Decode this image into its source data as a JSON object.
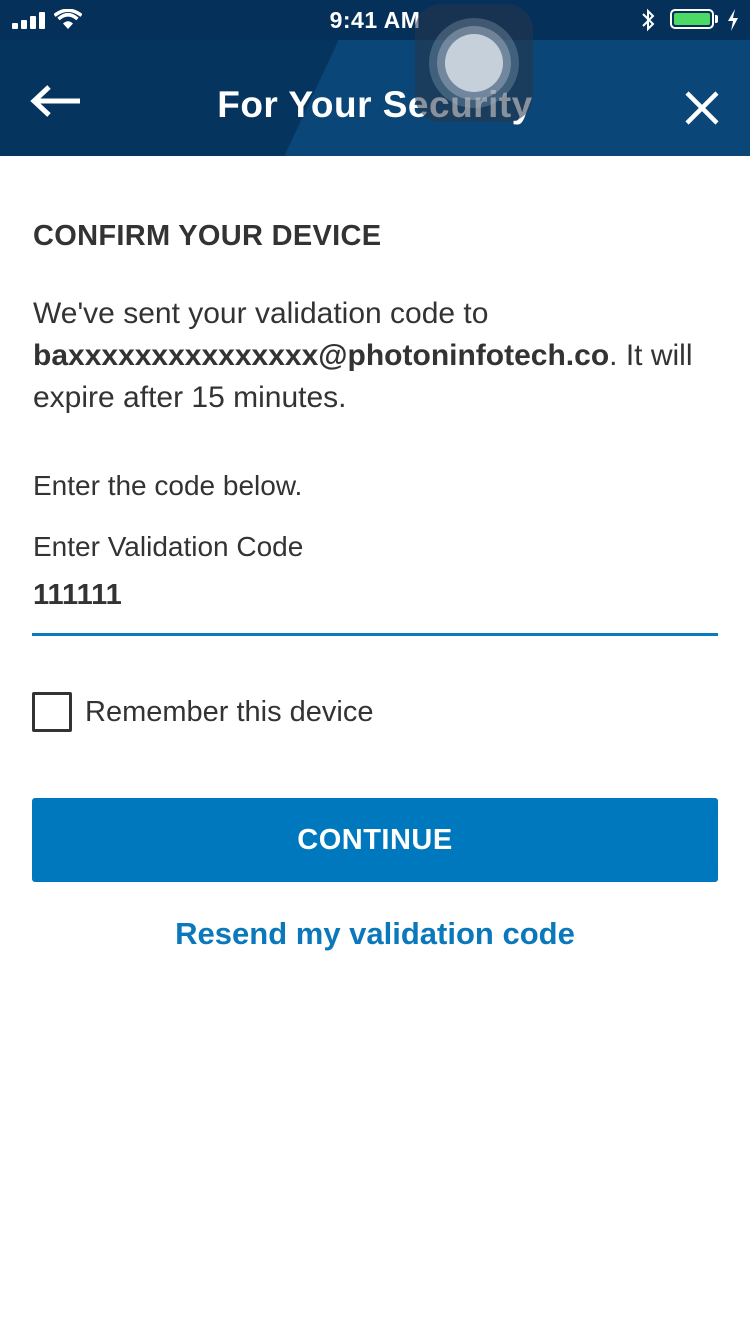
{
  "status_bar": {
    "time": "9:41 AM",
    "icons": [
      "signal-icon",
      "wifi-icon",
      "bluetooth-icon",
      "battery-icon",
      "charging-icon"
    ]
  },
  "nav": {
    "title": "For Your Security",
    "back_icon": "back-arrow-icon",
    "close_icon": "close-icon"
  },
  "content": {
    "heading": "CONFIRM YOUR DEVICE",
    "message_prefix": "We've sent your validation code to ",
    "email": "baxxxxxxxxxxxxxxx@photoninfotech.co",
    "message_suffix": ". It will expire after 15 minutes.",
    "prompt": "Enter the code below.",
    "field_label": "Enter Validation Code",
    "field_value": "111111",
    "checkbox_label": "Remember this device",
    "checkbox_checked": false,
    "continue_label": "CONTINUE",
    "resend_label": "Resend my validation code"
  },
  "colors": {
    "header_dark": "#05345f",
    "header_light": "#0a4677",
    "accent": "#0078be",
    "link": "#0a78ba",
    "text": "#333333",
    "battery": "#4cd964"
  }
}
